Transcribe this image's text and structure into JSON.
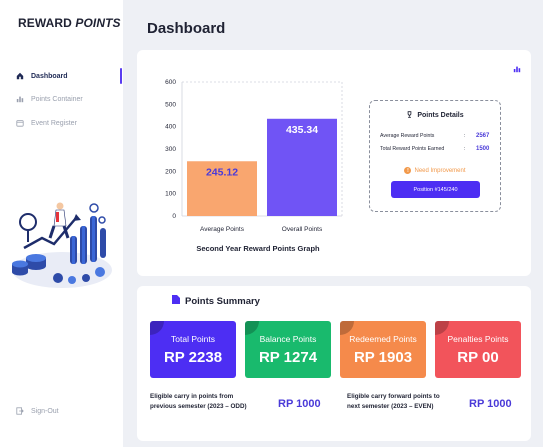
{
  "brand": {
    "part1": "REWARD",
    "part2": "POINTS"
  },
  "nav": [
    {
      "label": "Dashboard",
      "icon": "home-icon"
    },
    {
      "label": "Points Container",
      "icon": "bar-chart-icon"
    },
    {
      "label": "Event Register",
      "icon": "calendar-icon"
    }
  ],
  "signout": {
    "label": "Sign-Out",
    "icon": "sign-out-icon"
  },
  "page": {
    "title": "Dashboard"
  },
  "chart_data": {
    "type": "bar",
    "categories": [
      "Average Points",
      "Overall Points"
    ],
    "values": [
      245.12,
      435.34
    ],
    "value_labels": [
      "245.12",
      "435.34"
    ],
    "colors": [
      "#f9a66f",
      "#7054f5"
    ],
    "label_colors": [
      "#4a3ad8",
      "#ffffff"
    ],
    "title": "Second Year  Reward Points Graph",
    "ylim": [
      0,
      600
    ],
    "yticks": [
      "0",
      "100",
      "200",
      "300",
      "400",
      "500",
      "600"
    ],
    "grid": false
  },
  "details": {
    "title": "Points Details",
    "icon": "trophy-icon",
    "rows": [
      {
        "label": "Average Reward Points",
        "colon": ":",
        "value": "2567"
      },
      {
        "label": "Total Reward Points Earned",
        "colon": ":",
        "value": "1500"
      }
    ],
    "status": "Need Improvement",
    "status_color": "#f2994a",
    "position_button": "Position #145/240"
  },
  "summary": {
    "title": "Points Summary",
    "icon": "document-icon",
    "tiles": [
      {
        "label": "Total Points",
        "value": "RP 2238",
        "color": "#4d2ef3"
      },
      {
        "label": "Balance Points",
        "value": "RP 1274",
        "color": "#19ba6d"
      },
      {
        "label": "Redeemed Points",
        "value": "RP 1903",
        "color": "#f58a4b"
      },
      {
        "label": "Penalties Points",
        "value": "RP 00",
        "color": "#f2545b"
      }
    ],
    "carry_odd": {
      "line1": "Eligible carry in points from",
      "line2": "previous semester (2023 – ODD)",
      "value": "RP 1000"
    },
    "carry_even": {
      "line1": "Eligible carry forward points to",
      "line2": "next semester (2023 – EVEN)",
      "value": "RP 1000"
    }
  }
}
